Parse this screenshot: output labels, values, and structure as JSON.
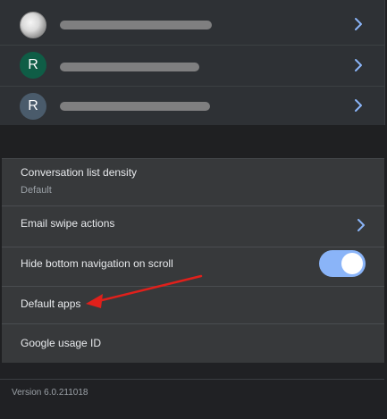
{
  "accounts": [
    {
      "avatar_letter": "",
      "avatar_kind": "photo"
    },
    {
      "avatar_letter": "R",
      "avatar_kind": "green"
    },
    {
      "avatar_letter": "R",
      "avatar_kind": "slate"
    }
  ],
  "settings": {
    "density_label": "Conversation list density",
    "density_value": "Default",
    "swipe_label": "Email swipe actions",
    "hide_nav_label": "Hide bottom navigation on scroll",
    "hide_nav_enabled": true,
    "default_apps_label": "Default apps",
    "usage_id_label": "Google usage ID"
  },
  "footer": {
    "version": "Version 6.0.211018"
  },
  "colors": {
    "accent": "#8ab4f8",
    "annotation_arrow": "#e0201b"
  },
  "icons": [
    "chevron-right-icon",
    "toggle-switch",
    "red-arrow-annotation"
  ]
}
